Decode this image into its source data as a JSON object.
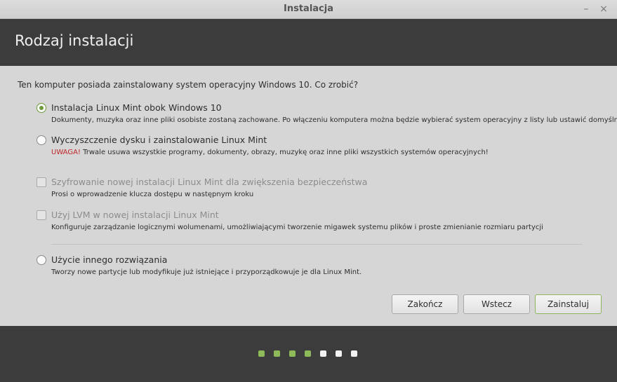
{
  "window": {
    "title": "Instalacja",
    "minimize_glyph": "–",
    "close_glyph": "×"
  },
  "header": {
    "title": "Rodzaj instalacji"
  },
  "question": "Ten komputer posiada zainstalowany system operacyjny Windows 10. Co zrobić?",
  "options": [
    {
      "type": "radio",
      "checked": true,
      "disabled": false,
      "label": "Instalacja Linux Mint obok Windows 10",
      "description": "Dokumenty, muzyka oraz inne pliki osobiste zostaną zachowane. Po włączeniu komputera można będzie wybierać system operacyjny z listy lub ustawić domyślny."
    },
    {
      "type": "radio",
      "checked": false,
      "disabled": false,
      "label": "Wyczyszczenie dysku i zainstalowanie Linux Mint",
      "warning": "UWAGA!",
      "description": " Trwale usuwa wszystkie programy, dokumenty, obrazy, muzykę oraz inne pliki wszystkich systemów operacyjnych!"
    },
    {
      "type": "checkbox",
      "checked": false,
      "disabled": true,
      "label": "Szyfrowanie nowej instalacji Linux Mint dla zwiększenia bezpieczeństwa",
      "description": "Prosi o wprowadzenie klucza dostępu w następnym kroku"
    },
    {
      "type": "checkbox",
      "checked": false,
      "disabled": true,
      "label": "Użyj LVM w nowej instalacji Linux Mint",
      "description": "Konfiguruje zarządzanie logicznymi wolumenami, umożliwiającymi tworzenie migawek systemu plików i proste zmienianie rozmiaru partycji"
    },
    {
      "type": "radio",
      "checked": false,
      "disabled": false,
      "label": "Użycie innego rozwiązania",
      "description": "Tworzy nowe partycje lub modyfikuje już istniejące i przyporządkowuje je dla Linux Mint."
    }
  ],
  "buttons": {
    "quit": "Zakończ",
    "back": "Wstecz",
    "install": "Zainstaluj"
  },
  "progress": {
    "completed_steps": 4,
    "total_steps": 7
  },
  "colors": {
    "accent": "#6f9a3b",
    "step_done": "#8fba5a",
    "step_todo": "#f2f2f2",
    "warning": "#c0262a"
  }
}
